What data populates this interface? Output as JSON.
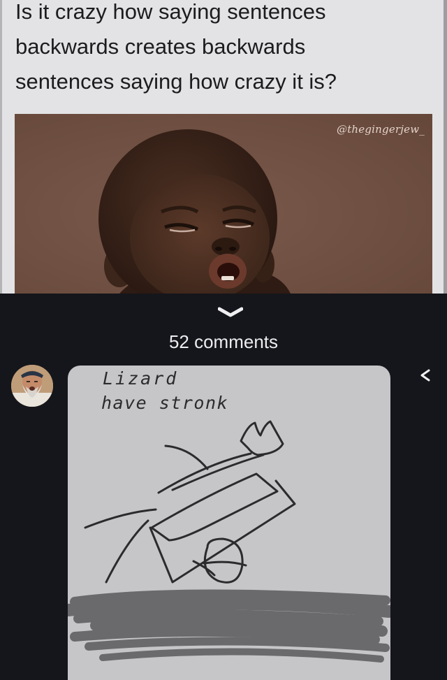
{
  "post": {
    "text": "Is it crazy how saying sentences backwards creates backwards sentences saying how crazy it is?",
    "image": {
      "watermark": "@thegingerjew_",
      "background_color": "#6e4f42"
    }
  },
  "comments": {
    "count_label": "52 comments",
    "items": [
      {
        "avatar": "bearded-man-avatar",
        "content_type": "drawing",
        "drawing_text": [
          "Lizard",
          "have stronk"
        ]
      }
    ]
  },
  "icons": {
    "collapse": "chevron-down-icon",
    "reply": "reply-icon"
  },
  "colors": {
    "app_background": "#15161b",
    "post_background": "#e3e3e5",
    "comment_bubble": "#c6c6c9",
    "ink": "#2b2b2e",
    "scribble": "#6a6a6d"
  }
}
